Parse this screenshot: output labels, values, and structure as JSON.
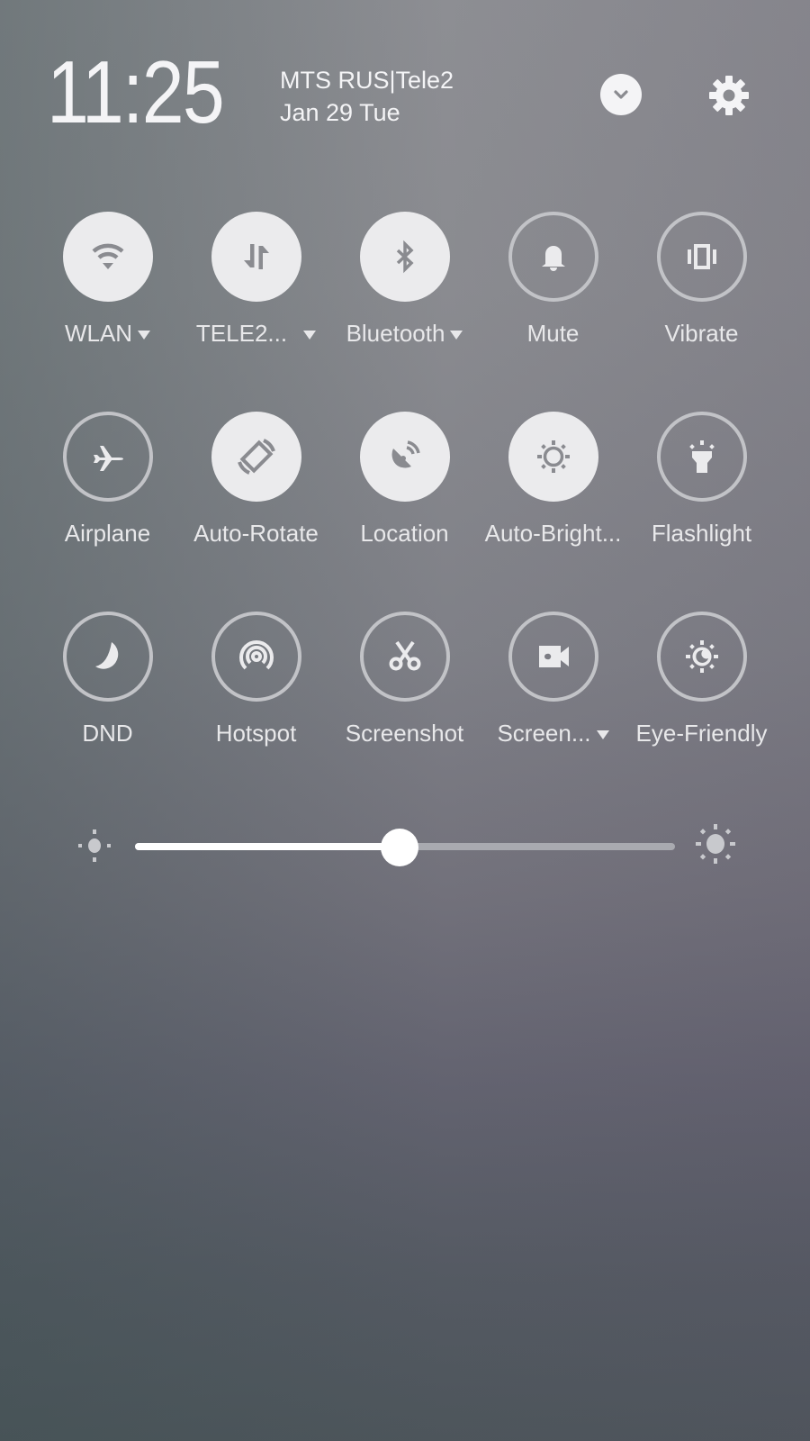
{
  "header": {
    "time": "11:25",
    "carrier": "MTS RUS|Tele2",
    "date": "Jan 29 Tue",
    "expand_icon": "chevron-down-icon",
    "settings_icon": "gear-icon"
  },
  "tiles": [
    {
      "label": "WLAN",
      "icon": "wifi-icon",
      "state": "on",
      "has_dropdown": true
    },
    {
      "label": "TELE2...",
      "icon": "mobile-data-icon",
      "state": "on",
      "has_dropdown": true
    },
    {
      "label": "Bluetooth",
      "icon": "bluetooth-icon",
      "state": "on",
      "has_dropdown": true
    },
    {
      "label": "Mute",
      "icon": "bell-icon",
      "state": "off",
      "has_dropdown": false
    },
    {
      "label": "Vibrate",
      "icon": "vibrate-icon",
      "state": "off",
      "has_dropdown": false
    },
    {
      "label": "Airplane",
      "icon": "airplane-icon",
      "state": "off",
      "has_dropdown": false
    },
    {
      "label": "Auto-Rotate",
      "icon": "rotate-icon",
      "state": "on",
      "has_dropdown": false
    },
    {
      "label": "Location",
      "icon": "location-icon",
      "state": "on",
      "has_dropdown": false
    },
    {
      "label": "Auto-Bright...",
      "icon": "brightness-icon",
      "state": "on",
      "has_dropdown": false
    },
    {
      "label": "Flashlight",
      "icon": "flashlight-icon",
      "state": "off",
      "has_dropdown": false
    },
    {
      "label": "DND",
      "icon": "moon-icon",
      "state": "off",
      "has_dropdown": false
    },
    {
      "label": "Hotspot",
      "icon": "hotspot-icon",
      "state": "off",
      "has_dropdown": false
    },
    {
      "label": "Screenshot",
      "icon": "scissors-icon",
      "state": "off",
      "has_dropdown": false
    },
    {
      "label": "Screen...",
      "icon": "video-camera-icon",
      "state": "off",
      "has_dropdown": true
    },
    {
      "label": "Eye-Friendly",
      "icon": "eye-friendly-icon",
      "state": "off",
      "has_dropdown": false
    }
  ],
  "brightness": {
    "value_percent": 49,
    "low_icon": "brightness-low-icon",
    "high_icon": "brightness-high-icon"
  },
  "colors": {
    "tile_on_bg": "#ebebed",
    "tile_off_ring": "#c2c3c7",
    "icon_on": "#8a8b90",
    "icon_off": "#ebebed",
    "slider_fill": "#ffffff",
    "slider_track": "#a9aab0"
  }
}
